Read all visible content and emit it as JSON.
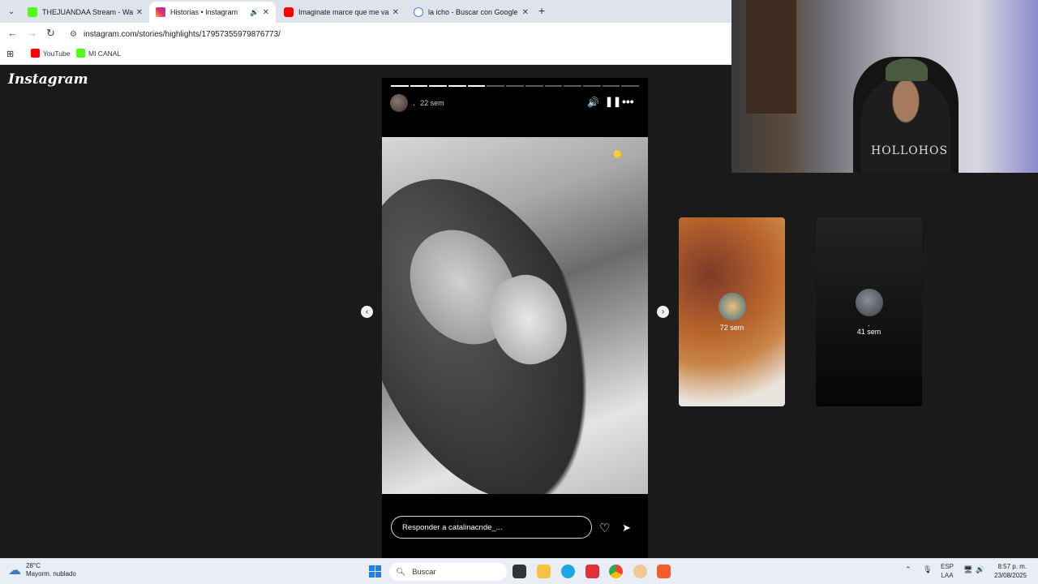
{
  "browser": {
    "tabs": [
      {
        "title": "THEJUANDAA Stream - Watch L",
        "favicon_color": "#53fc18"
      },
      {
        "title": "Historias • Instagram",
        "favicon_color": "#e1306c",
        "active": true
      },
      {
        "title": "Imaginate marce que me van a",
        "favicon_color": "#ff0000"
      },
      {
        "title": "la icho - Buscar con Google",
        "favicon_color": "#4285f4"
      }
    ],
    "url": "instagram.com/stories/highlights/17957355979876773/",
    "bookmarks": [
      {
        "label": "YouTube",
        "color": "#ff0000"
      },
      {
        "label": "MI CANAL",
        "color": "#53fc18"
      }
    ]
  },
  "instagram": {
    "logo": "Instagram",
    "story": {
      "segments_total": 13,
      "segments_done": 5,
      "username": ".",
      "time": "22 sem",
      "reply_placeholder": "Responder a catalinacnde_..."
    },
    "previews": [
      {
        "time": "72 sem"
      },
      {
        "name": ".",
        "time": "41 sem"
      }
    ]
  },
  "taskbar": {
    "temp": "28°C",
    "weather": "Mayorm. nublado",
    "search": "Buscar",
    "lang1": "ESP",
    "lang2": "LAA",
    "time": "8:57 p. m.",
    "date": "23/08/2025"
  },
  "webcam": {
    "shirt_text": "HOLLOHOS"
  }
}
